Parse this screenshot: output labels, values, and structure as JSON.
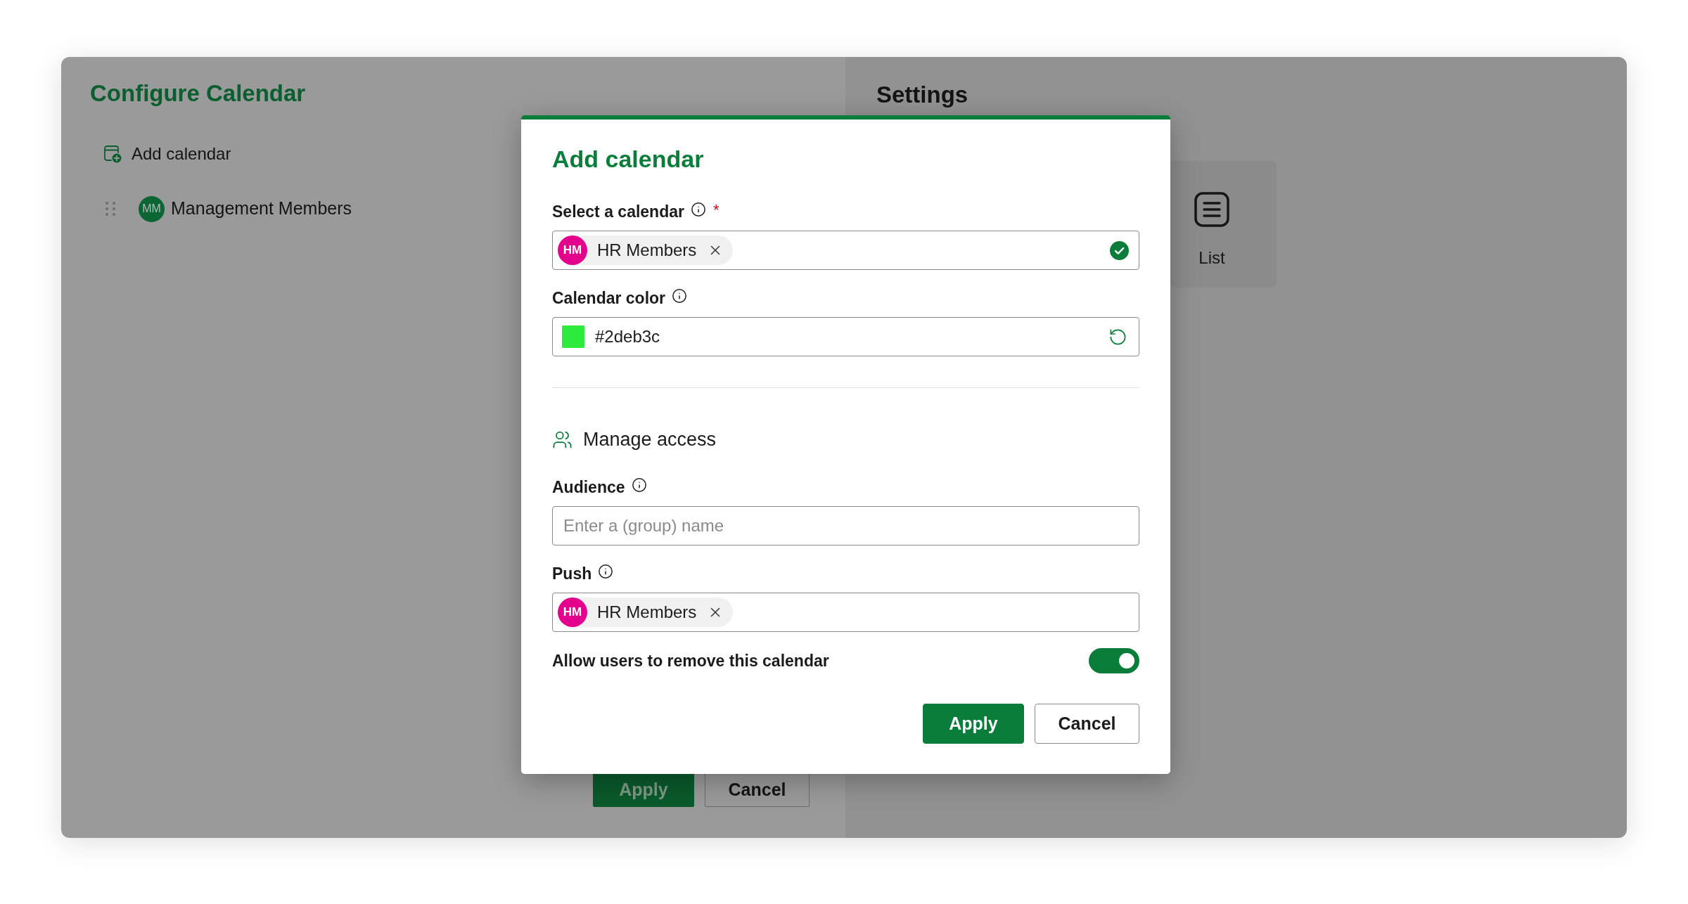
{
  "left_panel": {
    "title": "Configure Calendar",
    "add_button": "Add calendar",
    "calendars": [
      {
        "initials": "MM",
        "name": "Management Members",
        "color": "#0b6633"
      }
    ],
    "buttons": [
      {
        "label": "Apply",
        "kind": "primary"
      },
      {
        "label": "Cancel",
        "kind": "secondary"
      }
    ]
  },
  "settings_panel": {
    "title": "Settings",
    "views": [
      {
        "label": "List"
      }
    ]
  },
  "dialog": {
    "title": "Add calendar",
    "fields": [
      {
        "kind": "picker",
        "label": "Select a calendar",
        "info": true,
        "required_mark": "*",
        "chips": [
          {
            "initials": "HM",
            "name": "HR Members",
            "color": "#e3008c"
          }
        ],
        "valid": true
      },
      {
        "kind": "color",
        "label": "Calendar color",
        "info": true,
        "value": "#2deb3c",
        "color": "#2deb3c"
      }
    ],
    "access": {
      "title": "Manage access",
      "fields": [
        {
          "kind": "text",
          "label": "Audience",
          "info": true,
          "placeholder": "Enter a (group) name"
        },
        {
          "kind": "picker",
          "label": "Push",
          "info": true,
          "chips": [
            {
              "initials": "HM",
              "name": "HR Members",
              "color": "#e3008c"
            }
          ],
          "valid": false
        }
      ]
    },
    "toggle": {
      "label": "Allow users to remove this calendar",
      "on": true
    },
    "buttons": [
      {
        "label": "Apply",
        "kind": "primary"
      },
      {
        "label": "Cancel",
        "kind": "secondary"
      }
    ]
  }
}
